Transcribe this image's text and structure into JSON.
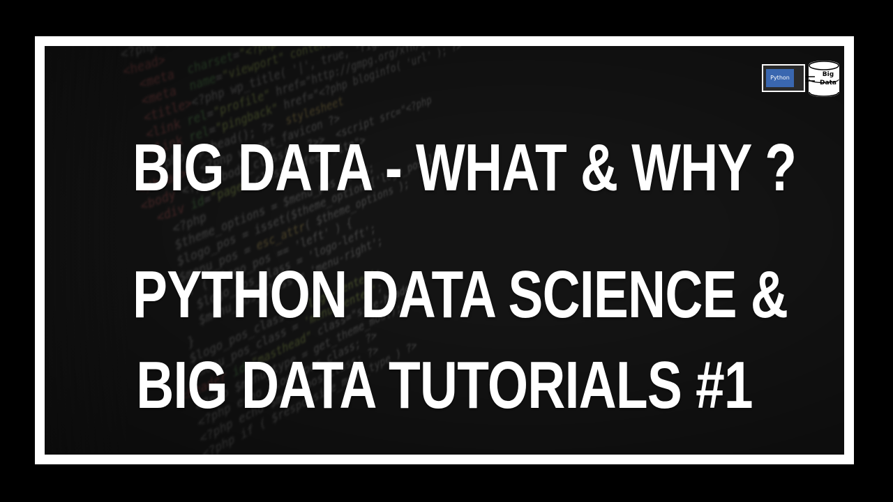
{
  "title": {
    "line1": "BIG DATA - WHAT & WHY ?",
    "line2": "PYTHON DATA SCIENCE &",
    "line3": "BIG DATA TUTORIALS #1"
  },
  "logo": {
    "python_label": "Python",
    "big_label": "Big",
    "data_label": "Data"
  },
  "colors": {
    "frame": "#ffffff",
    "outer": "#000000",
    "text": "#ffffff",
    "logo_accent": "#3a67b0"
  }
}
